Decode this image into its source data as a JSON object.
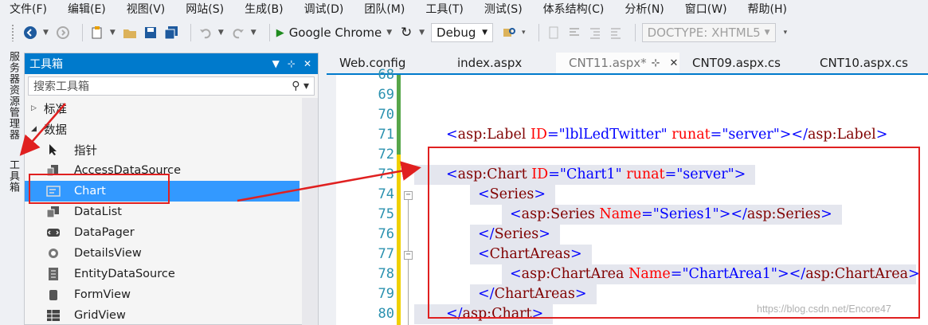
{
  "menu": [
    "文件(F)",
    "编辑(E)",
    "视图(V)",
    "网站(S)",
    "生成(B)",
    "调试(D)",
    "团队(M)",
    "工具(T)",
    "测试(S)",
    "体系结构(C)",
    "分析(N)",
    "窗口(W)",
    "帮助(H)"
  ],
  "toolbar": {
    "browser": "Google Chrome",
    "config": "Debug",
    "doctype": "DOCTYPE: XHTML5"
  },
  "side_tabs": [
    "服务器资源管理器",
    "工具箱"
  ],
  "toolbox": {
    "title": "工具箱",
    "search_placeholder": "搜索工具箱",
    "groups": [
      {
        "label": "标准",
        "expanded": false
      },
      {
        "label": "数据",
        "expanded": true
      }
    ],
    "items": [
      "指针",
      "AccessDataSource",
      "Chart",
      "DataList",
      "DataPager",
      "DetailsView",
      "EntityDataSource",
      "FormView",
      "GridView"
    ],
    "selected": "Chart"
  },
  "doc_tabs": [
    {
      "label": "Web.config",
      "active": false
    },
    {
      "label": "index.aspx",
      "active": false
    },
    {
      "label": "CNT11.aspx*",
      "active": true,
      "pin": "⊹",
      "close": "✕"
    },
    {
      "label": "CNT09.aspx.cs",
      "active": false
    },
    {
      "label": "CNT10.aspx.cs",
      "active": false
    }
  ],
  "editor": {
    "line_numbers": [
      "68",
      "69",
      "70",
      "71",
      "72",
      "73",
      "74",
      "75",
      "76",
      "77",
      "78",
      "79",
      "80"
    ],
    "lines": [
      {
        "n": "71",
        "indent": 0,
        "parts": [
          [
            "br",
            "<"
          ],
          [
            "tag",
            "asp:Label"
          ],
          [
            "txt",
            " "
          ],
          [
            "attr",
            "ID"
          ],
          [
            "br",
            "="
          ],
          [
            "val",
            "\"lblLedTwitter\""
          ],
          [
            "txt",
            " "
          ],
          [
            "attr",
            "runat"
          ],
          [
            "br",
            "="
          ],
          [
            "val",
            "\"server\""
          ],
          [
            "br",
            "></"
          ],
          [
            "tag",
            "asp:Label"
          ],
          [
            "br",
            ">"
          ]
        ]
      },
      {
        "n": "73",
        "indent": 0,
        "parts": [
          [
            "br",
            "<"
          ],
          [
            "tag",
            "asp:Chart"
          ],
          [
            "txt",
            " "
          ],
          [
            "attr",
            "ID"
          ],
          [
            "br",
            "="
          ],
          [
            "val",
            "\"Chart1\""
          ],
          [
            "txt",
            " "
          ],
          [
            "attr",
            "runat"
          ],
          [
            "br",
            "="
          ],
          [
            "val",
            "\"server\""
          ],
          [
            "br",
            ">"
          ]
        ]
      },
      {
        "n": "74",
        "indent": 1,
        "parts": [
          [
            "br",
            "<"
          ],
          [
            "tag",
            "Series"
          ],
          [
            "br",
            ">"
          ]
        ]
      },
      {
        "n": "75",
        "indent": 2,
        "parts": [
          [
            "br",
            "<"
          ],
          [
            "tag",
            "asp:Series"
          ],
          [
            "txt",
            " "
          ],
          [
            "attr",
            "Name"
          ],
          [
            "br",
            "="
          ],
          [
            "val",
            "\"Series1\""
          ],
          [
            "br",
            "></"
          ],
          [
            "tag",
            "asp:Series"
          ],
          [
            "br",
            ">"
          ]
        ]
      },
      {
        "n": "76",
        "indent": 1,
        "parts": [
          [
            "br",
            "</"
          ],
          [
            "tag",
            "Series"
          ],
          [
            "br",
            ">"
          ]
        ]
      },
      {
        "n": "77",
        "indent": 1,
        "parts": [
          [
            "br",
            "<"
          ],
          [
            "tag",
            "ChartAreas"
          ],
          [
            "br",
            ">"
          ]
        ]
      },
      {
        "n": "78",
        "indent": 2,
        "parts": [
          [
            "br",
            "<"
          ],
          [
            "tag",
            "asp:ChartArea"
          ],
          [
            "txt",
            " "
          ],
          [
            "attr",
            "Name"
          ],
          [
            "br",
            "="
          ],
          [
            "val",
            "\"ChartArea1\""
          ],
          [
            "br",
            "></"
          ],
          [
            "tag",
            "asp:ChartArea"
          ],
          [
            "br",
            ">"
          ]
        ]
      },
      {
        "n": "79",
        "indent": 1,
        "parts": [
          [
            "br",
            "</"
          ],
          [
            "tag",
            "ChartAreas"
          ],
          [
            "br",
            ">"
          ]
        ]
      },
      {
        "n": "80",
        "indent": 0,
        "parts": [
          [
            "br",
            "</"
          ],
          [
            "tag",
            "asp:Chart"
          ],
          [
            "br",
            ">"
          ]
        ]
      }
    ]
  },
  "watermark": "https://blog.csdn.net/Encore47",
  "colors": {
    "accent": "#007acc",
    "selection": "#3399ff",
    "annotation": "#e02020"
  }
}
